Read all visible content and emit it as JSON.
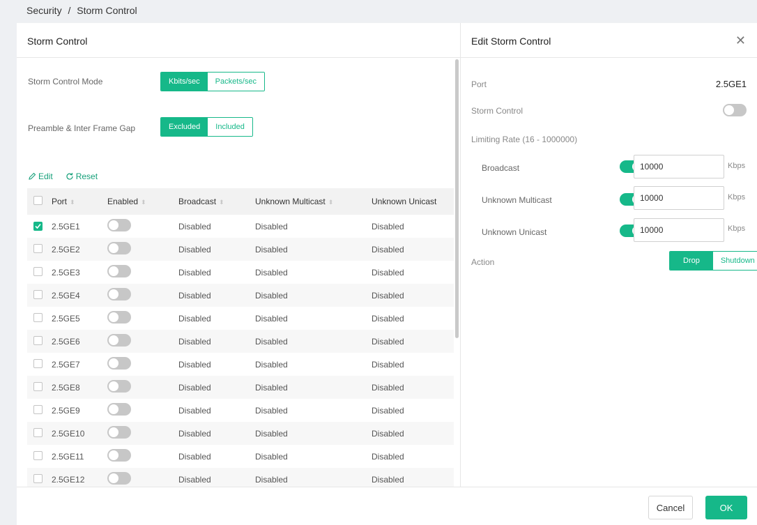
{
  "breadcrumb": {
    "section": "Security",
    "separator": "/",
    "page": "Storm Control"
  },
  "left_panel": {
    "title": "Storm Control",
    "mode_label": "Storm Control Mode",
    "mode_options": [
      "Kbits/sec",
      "Packets/sec"
    ],
    "mode_selected": "Kbits/sec",
    "gap_label": "Preamble & Inter Frame Gap",
    "gap_options": [
      "Excluded",
      "Included"
    ],
    "gap_selected": "Excluded",
    "edit_label": "Edit",
    "reset_label": "Reset"
  },
  "table": {
    "columns": [
      "Port",
      "Enabled",
      "Broadcast",
      "Unknown Multicast",
      "Unknown Unicast"
    ],
    "rows": [
      {
        "checked": true,
        "port": "2.5GE1",
        "enabled": false,
        "broadcast": "Disabled",
        "multicast": "Disabled",
        "unicast": "Disabled"
      },
      {
        "checked": false,
        "port": "2.5GE2",
        "enabled": false,
        "broadcast": "Disabled",
        "multicast": "Disabled",
        "unicast": "Disabled"
      },
      {
        "checked": false,
        "port": "2.5GE3",
        "enabled": false,
        "broadcast": "Disabled",
        "multicast": "Disabled",
        "unicast": "Disabled"
      },
      {
        "checked": false,
        "port": "2.5GE4",
        "enabled": false,
        "broadcast": "Disabled",
        "multicast": "Disabled",
        "unicast": "Disabled"
      },
      {
        "checked": false,
        "port": "2.5GE5",
        "enabled": false,
        "broadcast": "Disabled",
        "multicast": "Disabled",
        "unicast": "Disabled"
      },
      {
        "checked": false,
        "port": "2.5GE6",
        "enabled": false,
        "broadcast": "Disabled",
        "multicast": "Disabled",
        "unicast": "Disabled"
      },
      {
        "checked": false,
        "port": "2.5GE7",
        "enabled": false,
        "broadcast": "Disabled",
        "multicast": "Disabled",
        "unicast": "Disabled"
      },
      {
        "checked": false,
        "port": "2.5GE8",
        "enabled": false,
        "broadcast": "Disabled",
        "multicast": "Disabled",
        "unicast": "Disabled"
      },
      {
        "checked": false,
        "port": "2.5GE9",
        "enabled": false,
        "broadcast": "Disabled",
        "multicast": "Disabled",
        "unicast": "Disabled"
      },
      {
        "checked": false,
        "port": "2.5GE10",
        "enabled": false,
        "broadcast": "Disabled",
        "multicast": "Disabled",
        "unicast": "Disabled"
      },
      {
        "checked": false,
        "port": "2.5GE11",
        "enabled": false,
        "broadcast": "Disabled",
        "multicast": "Disabled",
        "unicast": "Disabled"
      },
      {
        "checked": false,
        "port": "2.5GE12",
        "enabled": false,
        "broadcast": "Disabled",
        "multicast": "Disabled",
        "unicast": "Disabled"
      }
    ]
  },
  "edit_panel": {
    "title": "Edit Storm Control",
    "port_label": "Port",
    "port_value": "2.5GE1",
    "storm_control_label": "Storm Control",
    "storm_control_on": false,
    "limiting_rate_label": "Limiting Rate (16 - 1000000)",
    "rates": [
      {
        "label": "Broadcast",
        "enabled": true,
        "value": "10000",
        "unit": "Kbps"
      },
      {
        "label": "Unknown Multicast",
        "enabled": true,
        "value": "10000",
        "unit": "Kbps"
      },
      {
        "label": "Unknown Unicast",
        "enabled": true,
        "value": "10000",
        "unit": "Kbps"
      }
    ],
    "action_label": "Action",
    "action_options": [
      "Drop",
      "Shutdown"
    ],
    "action_selected": "Drop"
  },
  "footer": {
    "cancel_label": "Cancel",
    "ok_label": "OK"
  },
  "colors": {
    "accent": "#16b889"
  }
}
